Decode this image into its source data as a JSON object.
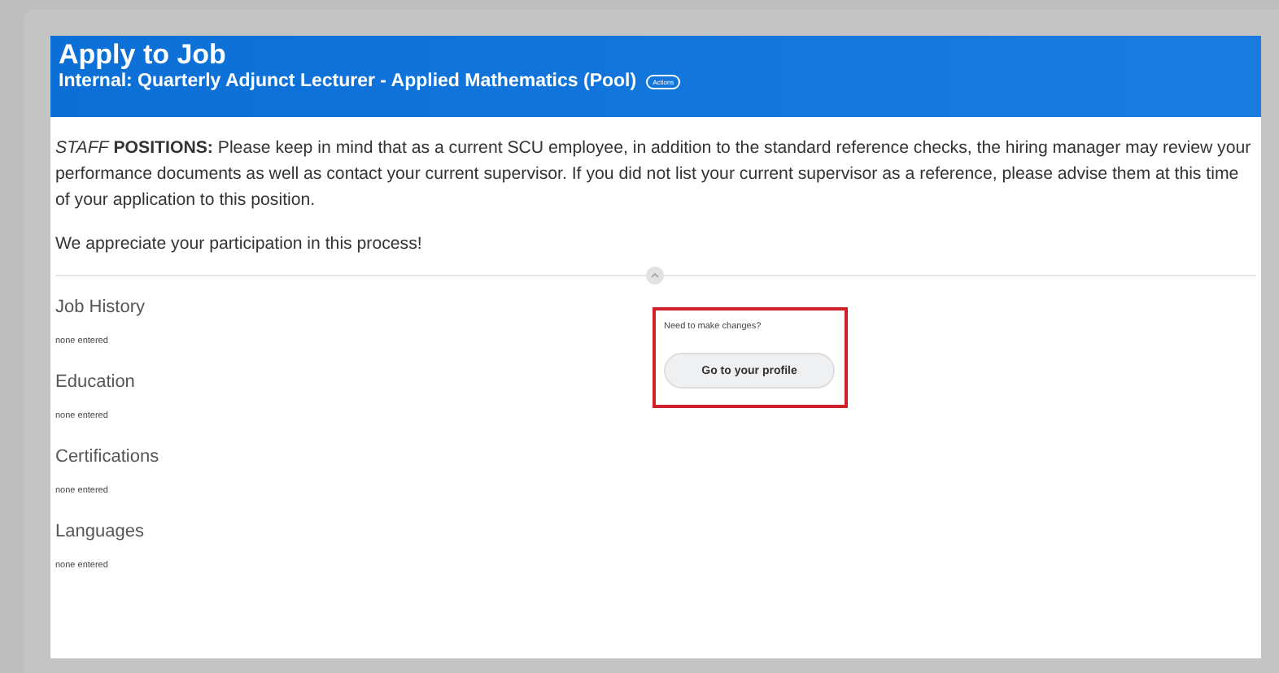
{
  "header": {
    "title": "Apply to Job",
    "subtitle": "Internal: Quarterly Adjunct Lecturer - Applied Mathematics (Pool)",
    "actions_label": "Actions"
  },
  "notice": {
    "text": "*STAFF* **POSITIONS:** Please keep in mind that as a current SCU employee, in addition to the standard reference checks, the hiring manager may review your performance documents as well as contact your current supervisor.  If you did not list your current supervisor as a reference, please advise them at this time of your application to this position.",
    "thanks": "We appreciate your participation in this process!"
  },
  "sections": [
    {
      "title": "Job History",
      "value": "none entered"
    },
    {
      "title": "Education",
      "value": "none entered"
    },
    {
      "title": "Certifications",
      "value": "none entered"
    },
    {
      "title": "Languages",
      "value": "none entered"
    }
  ],
  "profile_prompt": {
    "text": "Need to make changes?",
    "button": "Go to your profile",
    "highlighted": true
  }
}
